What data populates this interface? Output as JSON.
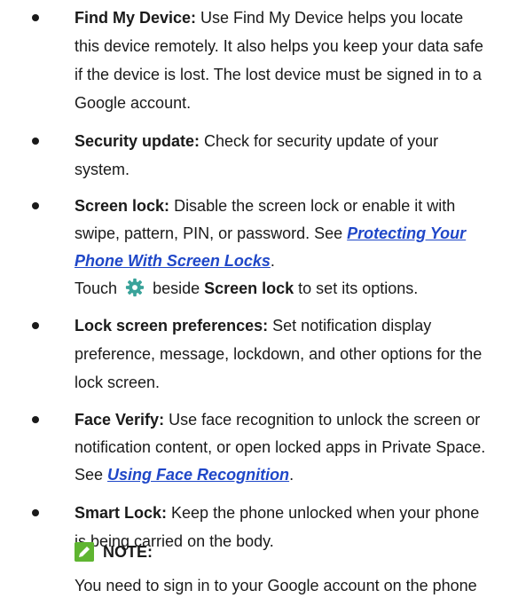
{
  "items": [
    {
      "term": "Find My Device:",
      "lines": [
        " Use Find My Device helps you locate",
        "this device remotely. It also helps you keep your data safe",
        "if the device is lost. The lost device must be signed in to a",
        "Google account."
      ]
    },
    {
      "term": "Security update:",
      "lines": [
        " Check for security update of your",
        "system."
      ]
    },
    {
      "term": "Screen lock:",
      "lines": [
        " Disable the screen lock or enable it with",
        "swipe, pattern, PIN, or password. See "
      ],
      "link_part1": "Protecting Your",
      "link_part2": "Phone With Screen Locks",
      "link_tail": ".",
      "extra": {
        "touch": "Touch",
        "beside": " beside ",
        "bold_target": "Screen lock",
        "tail": " to set its options.",
        "icon": "gear-icon"
      }
    },
    {
      "term": "Lock screen preferences:",
      "lines": [
        " Set notification display",
        "preference, message, lockdown, and other options for the",
        "lock screen."
      ]
    },
    {
      "term": "Face Verify:",
      "lines": [
        " Use face recognition to unlock the screen or",
        "notification content, or open locked apps in Private Space.",
        "See "
      ],
      "link": "Using Face Recognition",
      "link_tail": "."
    },
    {
      "term": "Smart Lock:",
      "lines": [
        " Keep the phone unlocked when your phone",
        "is being carried on the body."
      ]
    }
  ],
  "note": {
    "label": "NOTE:",
    "icon": "pencil-note-icon",
    "text": "You need to sign in to your Google account on the phone"
  },
  "colors": {
    "link": "#1f47c8",
    "gear": "#3aa39a",
    "note_icon": "#5fb531"
  }
}
